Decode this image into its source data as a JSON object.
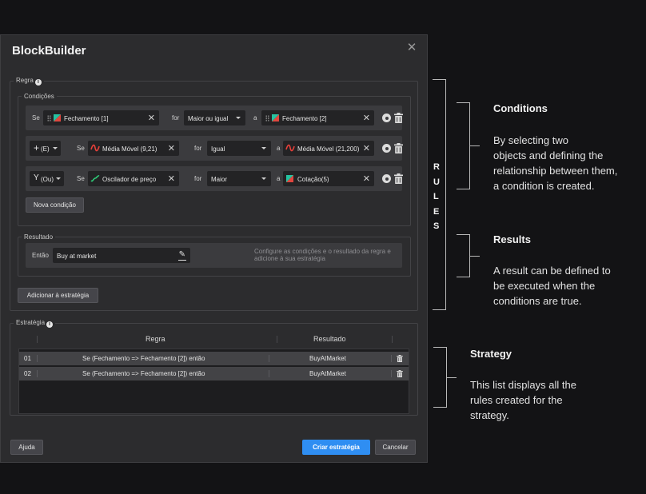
{
  "dialog": {
    "title": "BlockBuilder",
    "rule_legend": "Regra",
    "conditions_legend": "Condições",
    "conditions": [
      {
        "logic": "",
        "se": "Se",
        "left_operand": "Fechamento [1]",
        "left_icon": "flag-icon",
        "for": "for",
        "operator": "Maior ou igual",
        "a": "a",
        "right_operand": "Fechamento [2]",
        "right_icon": "flag-icon"
      },
      {
        "logic": "(E)",
        "logic_symbol": "+",
        "se": "Se",
        "left_operand": "Média Móvel (9,21)",
        "left_icon": "moving-average-icon",
        "for": "for",
        "operator": "Igual",
        "a": "a",
        "right_operand": "Média Móvel (21,200)",
        "right_icon": "moving-average-icon"
      },
      {
        "logic": "(Ou)",
        "logic_symbol": "Y",
        "se": "Se",
        "left_operand": "Oscilador de preço",
        "left_icon": "oscillator-icon",
        "for": "for",
        "operator": "Maior",
        "a": "a",
        "right_operand": "Cotação(5)",
        "right_icon": "flag-icon"
      }
    ],
    "new_condition_label": "Nova condição",
    "result_legend": "Resultado",
    "result_then": "Então",
    "result_value": "Buy at market",
    "result_hint": "Configure as condições e o resultado da regra e adicione à sua estratégia",
    "add_to_strategy_label": "Adicionar à estratégia",
    "strategy_legend": "Estratégia",
    "strategy_columns": [
      "Regra",
      "Resultado"
    ],
    "strategy_rows": [
      {
        "num": "01",
        "rule": "Se (Fechamento => Fechamento [2]) então",
        "result": "BuyAtMarket"
      },
      {
        "num": "02",
        "rule": "Se (Fechamento => Fechamento [2]) então",
        "result": "BuyAtMarket"
      }
    ],
    "help_label": "Ajuda",
    "create_label": "Criar estratégia",
    "cancel_label": "Cancelar"
  },
  "annotations": {
    "rules_letters": [
      "R",
      "U",
      "L",
      "E",
      "S"
    ],
    "conditions_title": "Conditions",
    "conditions_text": [
      "By selecting two",
      "objects and defining the",
      "relationship between them,",
      "a condition is created."
    ],
    "results_title": "Results",
    "results_text": [
      "A result can be defined to",
      "be executed when the",
      "conditions are true."
    ],
    "strategy_title": "Strategy",
    "strategy_text": [
      "This list displays all the",
      "rules created for the",
      "strategy."
    ]
  },
  "colors": {
    "primary_button": "#2f8ef2",
    "flag_red": "#e0463e",
    "flag_teal": "#25c2a0",
    "moving_average_red": "#e8403a",
    "oscillator_green": "#2fd07a"
  }
}
